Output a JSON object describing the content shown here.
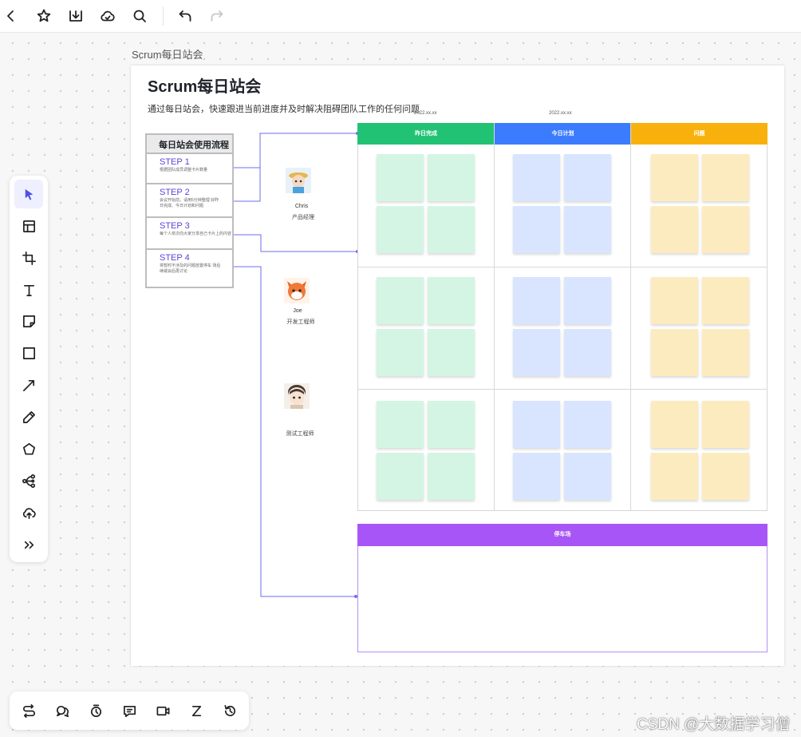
{
  "board": {
    "caption": "Scrum每日站会",
    "title": "Scrum每日站会",
    "description": "通过每日站会，快速跟进当前进度并及时解决阻碍团队工作的任何问题"
  },
  "flow": {
    "title": "每日站会使用流程",
    "steps": [
      {
        "label": "STEP 1",
        "desc": "根据团队成员调整卡片数量"
      },
      {
        "label": "STEP 2",
        "desc": "会议开始前，请用5分钟整理 好昨日完成、今日计划和问题"
      },
      {
        "label": "STEP 3",
        "desc": "每个人依次向大家分享自己卡片上的内容"
      },
      {
        "label": "STEP 4",
        "desc": "将暂时不涉及的问题放置停车 场后续或会后再讨论"
      }
    ]
  },
  "people": [
    {
      "name": "Chris",
      "role": "产品经理"
    },
    {
      "name": "Joe",
      "role": "开发工程师"
    },
    {
      "name": "",
      "role": "测试工程师"
    }
  ],
  "dates": [
    "2022.xx.xx",
    "2022.xx.xx"
  ],
  "columns": [
    {
      "label": "昨日完成",
      "color": "#22c274",
      "sticky": "#d4f5e4"
    },
    {
      "label": "今日计划",
      "color": "#3b7cff",
      "sticky": "#d9e5ff"
    },
    {
      "label": "问题",
      "color": "#f8b10c",
      "sticky": "#fdebc0"
    }
  ],
  "parking": {
    "label": "停车场",
    "color": "#a855f7"
  },
  "toolbar": {
    "top": [
      "back-icon",
      "star-icon",
      "download-icon",
      "cloud-icon",
      "search-icon",
      "undo-icon",
      "redo-icon"
    ],
    "left": [
      "select-icon",
      "template-icon",
      "frame-icon",
      "text-icon",
      "sticky-note-icon",
      "rectangle-icon",
      "line-icon",
      "pen-icon",
      "shape-icon",
      "mindmap-icon",
      "upload-icon",
      "more-icon"
    ],
    "bottom": [
      "flow-icon",
      "comment-icon",
      "timer-icon",
      "chat-icon",
      "video-icon",
      "z-icon",
      "history-icon"
    ]
  },
  "watermark": "CSDN @大数据学习僧"
}
